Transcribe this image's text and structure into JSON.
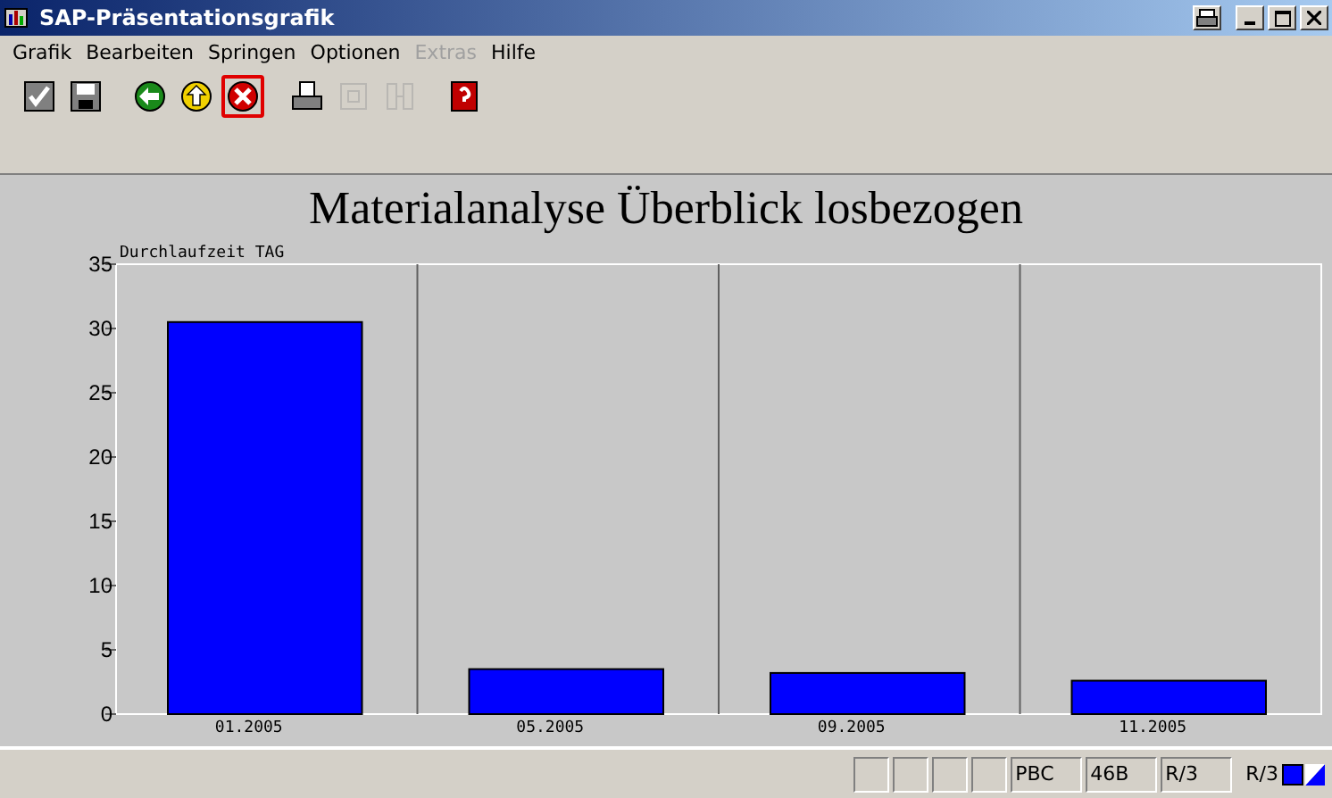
{
  "window": {
    "title": "SAP-Präsentationsgrafik"
  },
  "menu": [
    {
      "label": "Grafik",
      "disabled": false
    },
    {
      "label": "Bearbeiten",
      "disabled": false
    },
    {
      "label": "Springen",
      "disabled": false
    },
    {
      "label": "Optionen",
      "disabled": false
    },
    {
      "label": "Extras",
      "disabled": true
    },
    {
      "label": "Hilfe",
      "disabled": false
    }
  ],
  "toolbar": [
    {
      "kind": "check",
      "disabled": false,
      "focused": false
    },
    {
      "kind": "save",
      "disabled": false,
      "focused": false
    },
    {
      "kind": "back",
      "disabled": false,
      "focused": false
    },
    {
      "kind": "up",
      "disabled": false,
      "focused": false
    },
    {
      "kind": "cancel",
      "disabled": false,
      "focused": true
    },
    {
      "kind": "print",
      "disabled": false,
      "focused": false
    },
    {
      "kind": "find",
      "disabled": true,
      "focused": false
    },
    {
      "kind": "findnext",
      "disabled": true,
      "focused": false
    },
    {
      "kind": "help",
      "disabled": false,
      "focused": false
    }
  ],
  "chart": {
    "chart_data": {
      "type": "bar",
      "title": "Materialanalyse Überblick losbezogen",
      "ylabel": "Durchlaufzeit TAG",
      "categories": [
        "01.2005",
        "05.2005",
        "09.2005",
        "11.2005"
      ],
      "series": [
        {
          "color": "#0000ff",
          "values": [
            30.5,
            3.5,
            3.2,
            2.6
          ]
        }
      ],
      "ylim": [
        0,
        35
      ],
      "yticks": [
        0,
        5,
        10,
        15,
        20,
        25,
        30,
        35
      ]
    }
  },
  "status_bar": {
    "fields": [
      {
        "kind": "empty"
      },
      {
        "kind": "empty"
      },
      {
        "kind": "empty"
      },
      {
        "kind": "empty"
      },
      {
        "kind": "text",
        "text": "PBC"
      },
      {
        "kind": "text",
        "text": "46B"
      },
      {
        "kind": "text",
        "text": "R/3"
      }
    ],
    "system": "R/3"
  }
}
